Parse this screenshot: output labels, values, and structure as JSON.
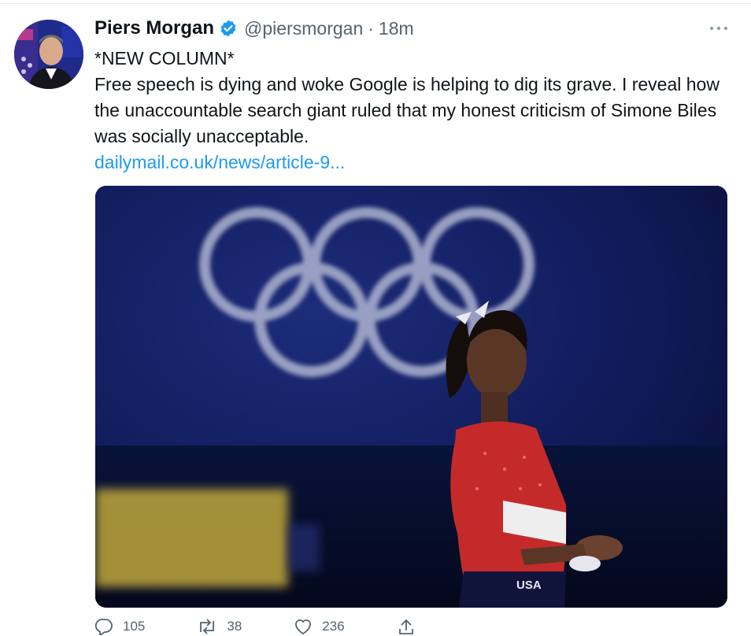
{
  "tweet": {
    "author_name": "Piers Morgan",
    "handle": "@piersmorgan",
    "separator": "·",
    "time": "18m",
    "text_line1": "*NEW COLUMN*",
    "text_line2": "Free speech is dying and woke Google is helping to dig its grave. I reveal how the unaccountable search giant ruled that my honest criticism of Simone Biles was socially unacceptable.",
    "link_text": "dailymail.co.uk/news/article-9...",
    "media_overlay_text": "USA"
  },
  "actions": {
    "reply_count": "105",
    "retweet_count": "38",
    "like_count": "236"
  },
  "colors": {
    "link": "#1d9bf0",
    "verified": "#1d9bf0",
    "secondary_text": "#536471"
  },
  "icons": {
    "verified": "verified-badge-icon",
    "more": "more-horizontal-icon",
    "reply": "reply-icon",
    "retweet": "retweet-icon",
    "like": "heart-icon",
    "share": "share-icon"
  }
}
